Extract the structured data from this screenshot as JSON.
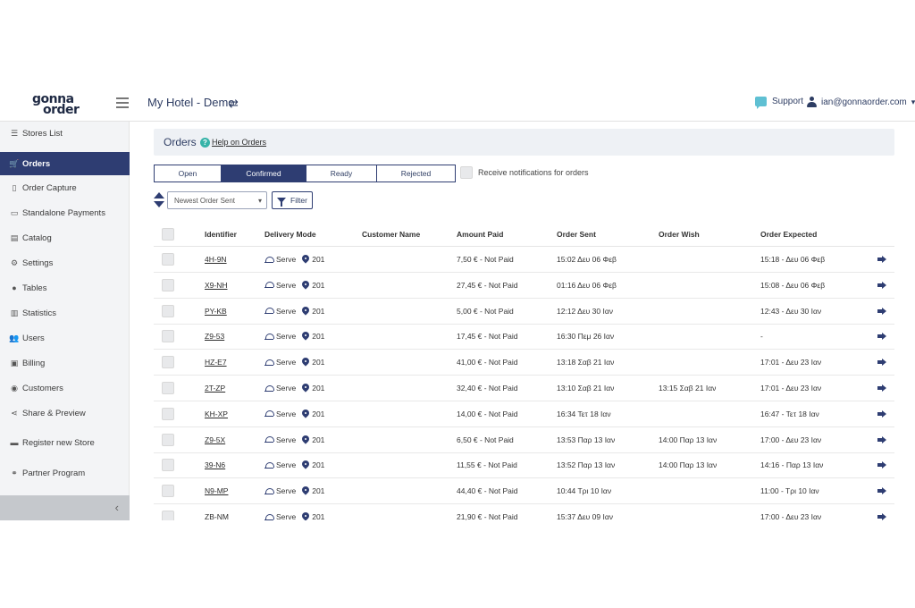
{
  "header": {
    "logo_line1": "gonna",
    "logo_line2": "order",
    "store_title": "My Hotel - Demo",
    "support_label": "Support",
    "user_email": "ian@gonnaorder.com"
  },
  "sidebar": {
    "items": [
      {
        "label": "Stores List",
        "icon": "list-icon"
      },
      {
        "label": "Orders",
        "icon": "cart-icon",
        "active": true
      },
      {
        "label": "Order Capture",
        "icon": "clipboard-icon"
      },
      {
        "label": "Standalone Payments",
        "icon": "card-icon"
      },
      {
        "label": "Catalog",
        "icon": "book-icon"
      },
      {
        "label": "Settings",
        "icon": "gears-icon"
      },
      {
        "label": "Tables",
        "icon": "pin-icon"
      },
      {
        "label": "Statistics",
        "icon": "chart-icon"
      },
      {
        "label": "Users",
        "icon": "users-icon"
      },
      {
        "label": "Billing",
        "icon": "wallet-icon"
      },
      {
        "label": "Customers",
        "icon": "user-circle-icon"
      },
      {
        "label": "Share & Preview",
        "icon": "share-icon"
      },
      {
        "label": "Register new Store",
        "icon": "store-icon"
      },
      {
        "label": "Partner Program",
        "icon": "handshake-icon"
      }
    ]
  },
  "orders": {
    "title": "Orders",
    "help_label": "Help on Orders",
    "tabs": [
      "Open",
      "Confirmed",
      "Ready",
      "Rejected"
    ],
    "active_tab": "Confirmed",
    "notifications_label": "Receive notifications for orders",
    "sort_value": "Newest Order Sent",
    "filter_label": "Filter"
  },
  "table": {
    "columns": [
      "Identifier",
      "Delivery Mode",
      "Customer Name",
      "Amount Paid",
      "Order Sent",
      "Order Wish",
      "Order Expected"
    ],
    "rows": [
      {
        "id": "4H-9N",
        "mode": "Serve",
        "table": "201",
        "customer": "",
        "amount": "7,50 € - Not Paid",
        "sent": "15:02 Δευ 06 Φεβ",
        "wish": "",
        "expected": "15:18 - Δευ 06 Φεβ"
      },
      {
        "id": "X9-NH",
        "mode": "Serve",
        "table": "201",
        "customer": "",
        "amount": "27,45 € - Not Paid",
        "sent": "01:16 Δευ 06 Φεβ",
        "wish": "",
        "expected": "15:08 - Δευ 06 Φεβ"
      },
      {
        "id": "PY-KB",
        "mode": "Serve",
        "table": "201",
        "customer": "",
        "amount": "5,00 € - Not Paid",
        "sent": "12:12 Δευ 30 Ιαν",
        "wish": "",
        "expected": "12:43 - Δευ 30 Ιαν"
      },
      {
        "id": "Z9-53",
        "mode": "Serve",
        "table": "201",
        "customer": "",
        "amount": "17,45 € - Not Paid",
        "sent": "16:30 Πεμ 26 Ιαν",
        "wish": "",
        "expected": "-"
      },
      {
        "id": "HZ-E7",
        "mode": "Serve",
        "table": "201",
        "customer": "",
        "amount": "41,00 € - Not Paid",
        "sent": "13:18 Σαβ 21 Ιαν",
        "wish": "",
        "expected": "17:01 - Δευ 23 Ιαν"
      },
      {
        "id": "2T-ZP",
        "mode": "Serve",
        "table": "201",
        "customer": "",
        "amount": "32,40 € - Not Paid",
        "sent": "13:10 Σαβ 21 Ιαν",
        "wish": "13:15 Σαβ 21 Ιαν",
        "expected": "17:01 - Δευ 23 Ιαν"
      },
      {
        "id": "KH-XP",
        "mode": "Serve",
        "table": "201",
        "customer": "",
        "amount": "14,00 € - Not Paid",
        "sent": "16:34 Τετ 18 Ιαν",
        "wish": "",
        "expected": "16:47 - Τετ 18 Ιαν"
      },
      {
        "id": "Z9-5X",
        "mode": "Serve",
        "table": "201",
        "customer": "",
        "amount": "6,50 € - Not Paid",
        "sent": "13:53 Παρ 13 Ιαν",
        "wish": "14:00 Παρ 13 Ιαν",
        "expected": "17:00 - Δευ 23 Ιαν"
      },
      {
        "id": "39-N6",
        "mode": "Serve",
        "table": "201",
        "customer": "",
        "amount": "11,55 € - Not Paid",
        "sent": "13:52 Παρ 13 Ιαν",
        "wish": "14:00 Παρ 13 Ιαν",
        "expected": "14:16 - Παρ 13 Ιαν"
      },
      {
        "id": "N9-MP",
        "mode": "Serve",
        "table": "201",
        "customer": "",
        "amount": "44,40 € - Not Paid",
        "sent": "10:44 Τρι 10 Ιαν",
        "wish": "",
        "expected": "11:00 - Τρι 10 Ιαν"
      },
      {
        "id": "ZB-NM",
        "mode": "Serve",
        "table": "201",
        "customer": "",
        "amount": "21,90 € - Not Paid",
        "sent": "15:37 Δευ 09 Ιαν",
        "wish": "",
        "expected": "17:00 - Δευ 23 Ιαν"
      }
    ]
  },
  "colors": {
    "primary": "#2e3d72",
    "sidebar_bg": "#f3f4f6",
    "accent": "#36b3a8"
  }
}
